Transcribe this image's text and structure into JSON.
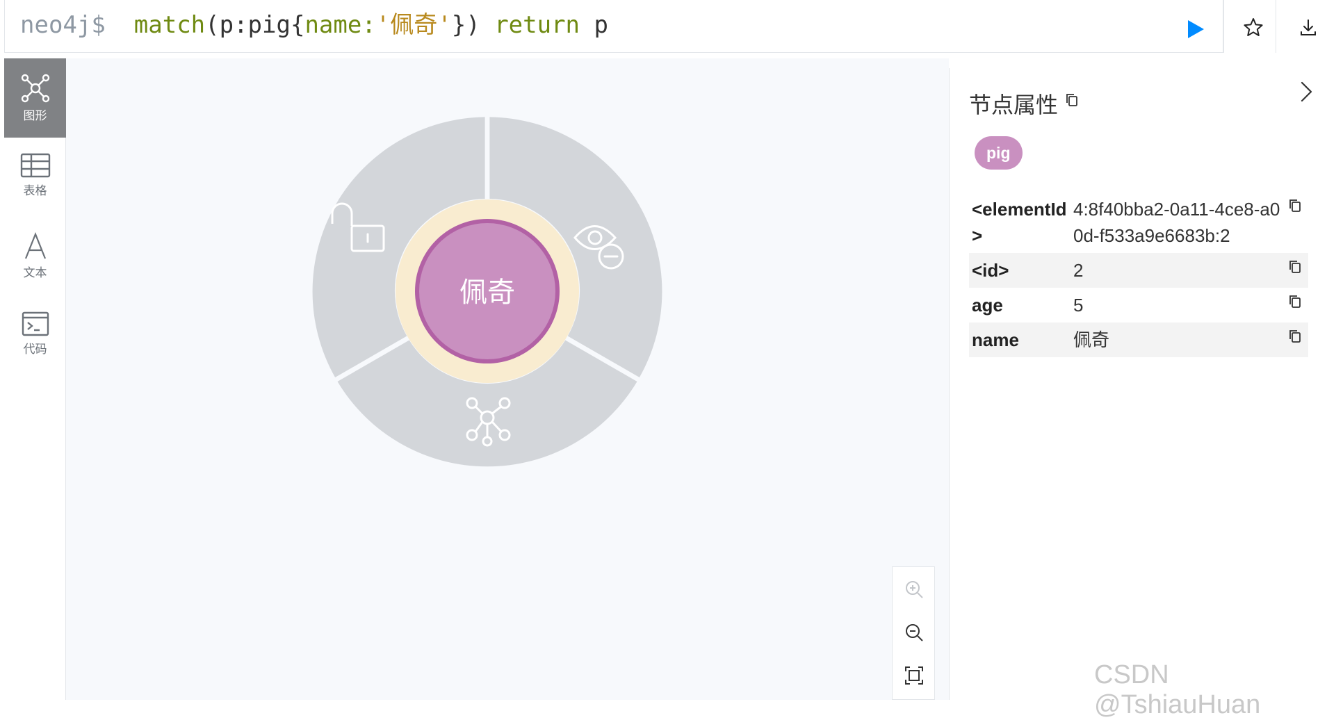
{
  "query": {
    "prompt": "neo4j$",
    "keyword_match": "match",
    "part_open": "(p:pig{",
    "prop_key": "name:",
    "prop_value": "'佩奇'",
    "part_close": "})",
    "keyword_return": "return",
    "return_var": "p"
  },
  "sidebar": {
    "items": [
      {
        "label": "图形",
        "icon": "graph-icon",
        "active": true
      },
      {
        "label": "表格",
        "icon": "table-icon",
        "active": false
      },
      {
        "label": "文本",
        "icon": "text-icon",
        "active": false
      },
      {
        "label": "代码",
        "icon": "code-icon",
        "active": false
      }
    ]
  },
  "graph": {
    "node_caption": "佩奇",
    "node_color": "#c990c0",
    "node_border_color": "#b261a5",
    "halo_color": "#f9ecd0",
    "ring_color": "#d3d6da",
    "ring_segments": [
      "unlock-icon",
      "hide-icon",
      "expand-icon"
    ]
  },
  "panel": {
    "title": "节点属性",
    "label_chip": "pig",
    "properties": [
      {
        "key": "<elementId>",
        "value": "4:8f40bba2-0a11-4ce8-a00d-f533a9e6683b:2"
      },
      {
        "key": "<id>",
        "value": "2"
      },
      {
        "key": "age",
        "value": "5"
      },
      {
        "key": "name",
        "value": "佩奇"
      }
    ]
  },
  "accent_color": "#018bff",
  "watermark": "CSDN @TshiauHuan"
}
